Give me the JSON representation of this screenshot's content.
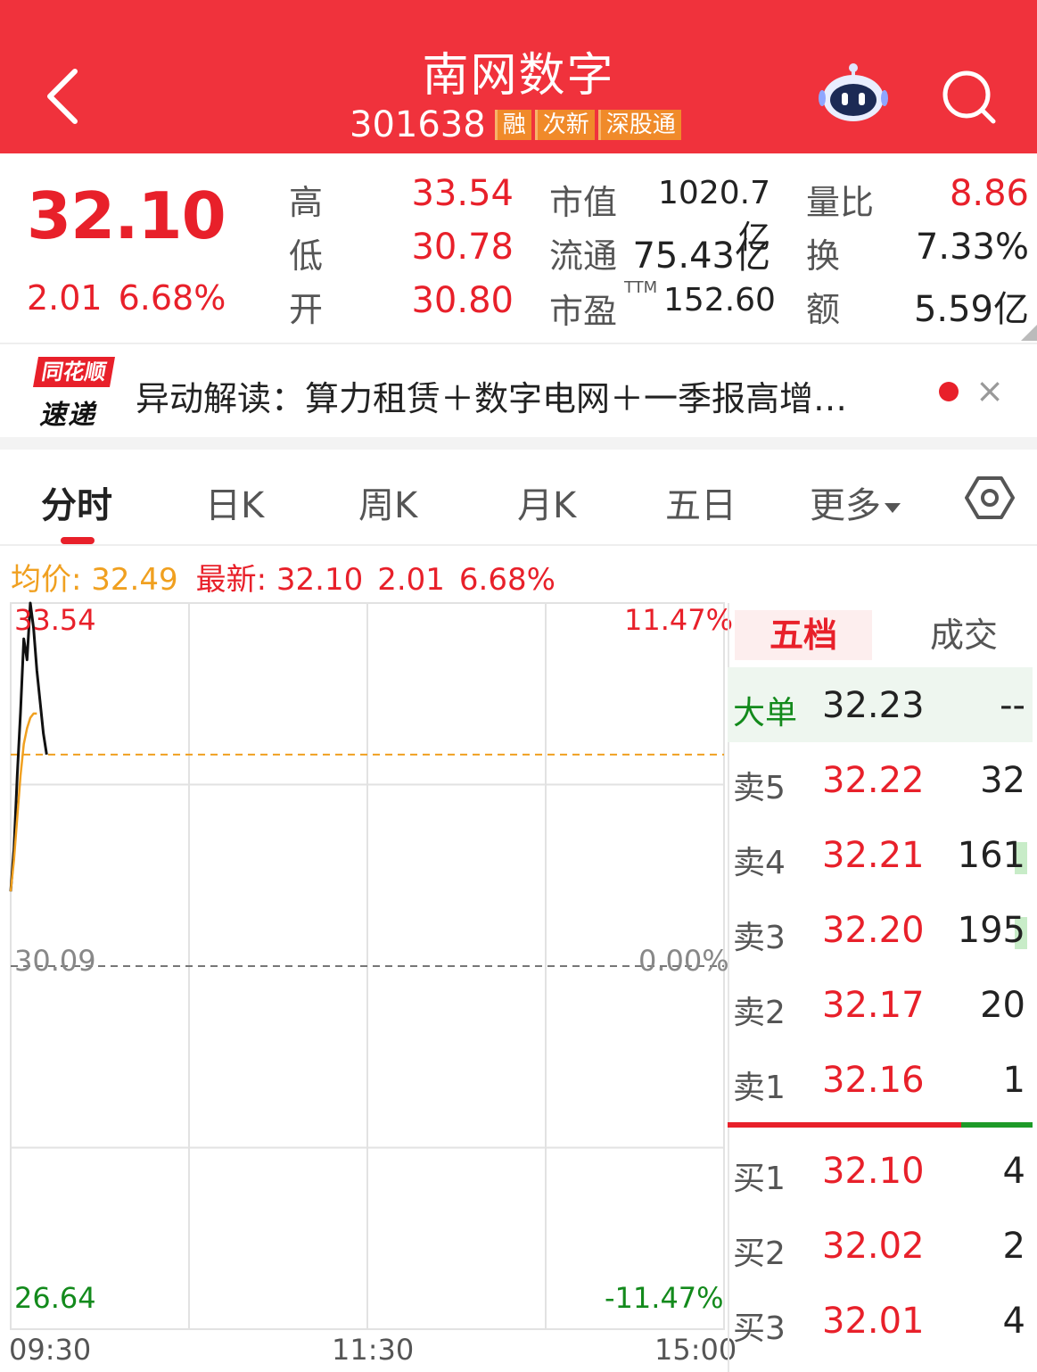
{
  "header": {
    "title": "南网数字",
    "code": "301638",
    "tags": [
      "融",
      "次新",
      "深股通"
    ]
  },
  "quote": {
    "price": "32.10",
    "change": "2.01",
    "change_pct": "6.68%",
    "high_label": "高",
    "high": "33.54",
    "low_label": "低",
    "low": "30.78",
    "open_label": "开",
    "open": "30.80",
    "mktcap_label": "市值",
    "mktcap": "1020.7亿",
    "float_label": "流通",
    "float": "75.43亿",
    "pe_label": "市盈",
    "pe_sup": "TTM",
    "pe": "152.60",
    "vol_ratio_label": "量比",
    "vol_ratio": "8.86",
    "turnover_label": "换",
    "turnover": "7.33%",
    "amount_label": "额",
    "amount": "5.59亿"
  },
  "news": {
    "logo_top": "同花顺",
    "logo_bottom": "速递",
    "text": "异动解读：算力租赁＋数字电网＋一季报高增…",
    "close": "×"
  },
  "tabs": [
    "分时",
    "日K",
    "周K",
    "月K",
    "五日",
    "更多"
  ],
  "info": {
    "avg": "均价: 32.49",
    "latest": "最新: 32.10",
    "change": "2.01",
    "change_pct": "6.68%"
  },
  "chart_data": {
    "type": "line",
    "y_top": "33.54",
    "y_mid": "30.09",
    "y_bottom": "26.64",
    "pct_top": "11.47%",
    "pct_mid": "0.00%",
    "pct_bottom": "-11.47%",
    "x_labels": [
      "09:30",
      "11:30",
      "15:00"
    ],
    "ylim": [
      26.64,
      33.54
    ],
    "prev_close": 30.09,
    "colors": {
      "price": "#111111",
      "avg": "#f0a020",
      "up": "#e8202a",
      "down": "#138a1c"
    },
    "series": [
      {
        "values": [
          30.8,
          31.2,
          31.9,
          32.5,
          33.2,
          33.0,
          33.54,
          33.3,
          32.9,
          32.6,
          32.3,
          32.1
        ]
      },
      {
        "values": [
          30.8,
          31.1,
          31.5,
          31.9,
          32.2,
          32.35,
          32.45,
          32.49,
          32.49
        ]
      }
    ]
  },
  "orderbook": {
    "tab_active": "五档",
    "tab_other": "成交",
    "big": {
      "label": "大单",
      "price": "32.23",
      "vol": "--"
    },
    "asks": [
      {
        "label": "卖5",
        "price": "32.22",
        "vol": "32",
        "bar": false
      },
      {
        "label": "卖4",
        "price": "32.21",
        "vol": "161",
        "bar": true
      },
      {
        "label": "卖3",
        "price": "32.20",
        "vol": "195",
        "bar": true
      },
      {
        "label": "卖2",
        "price": "32.17",
        "vol": "20",
        "bar": false
      },
      {
        "label": "卖1",
        "price": "32.16",
        "vol": "1",
        "bar": false
      }
    ],
    "bids": [
      {
        "label": "买1",
        "price": "32.10",
        "vol": "4"
      },
      {
        "label": "买2",
        "price": "32.02",
        "vol": "2"
      },
      {
        "label": "买3",
        "price": "32.01",
        "vol": "4"
      }
    ]
  }
}
